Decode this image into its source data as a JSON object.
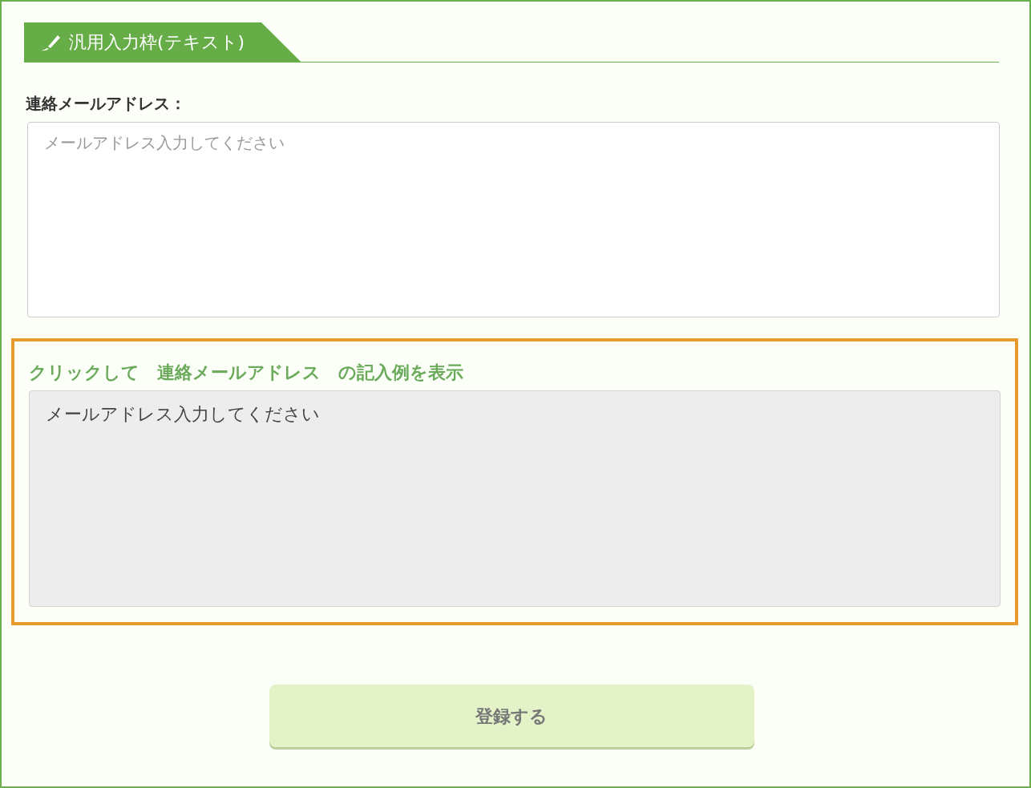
{
  "section_tab": {
    "label": "汎用入力枠(テキスト)"
  },
  "field": {
    "label": "連絡メールアドレス：",
    "placeholder": "メールアドレス入力してください"
  },
  "example": {
    "toggle": "クリックして　連絡メールアドレス　の記入例を表示",
    "text": "メールアドレス入力してください",
    "highlighted": true
  },
  "submit_button": {
    "label": "登録する",
    "disabled": true
  }
}
